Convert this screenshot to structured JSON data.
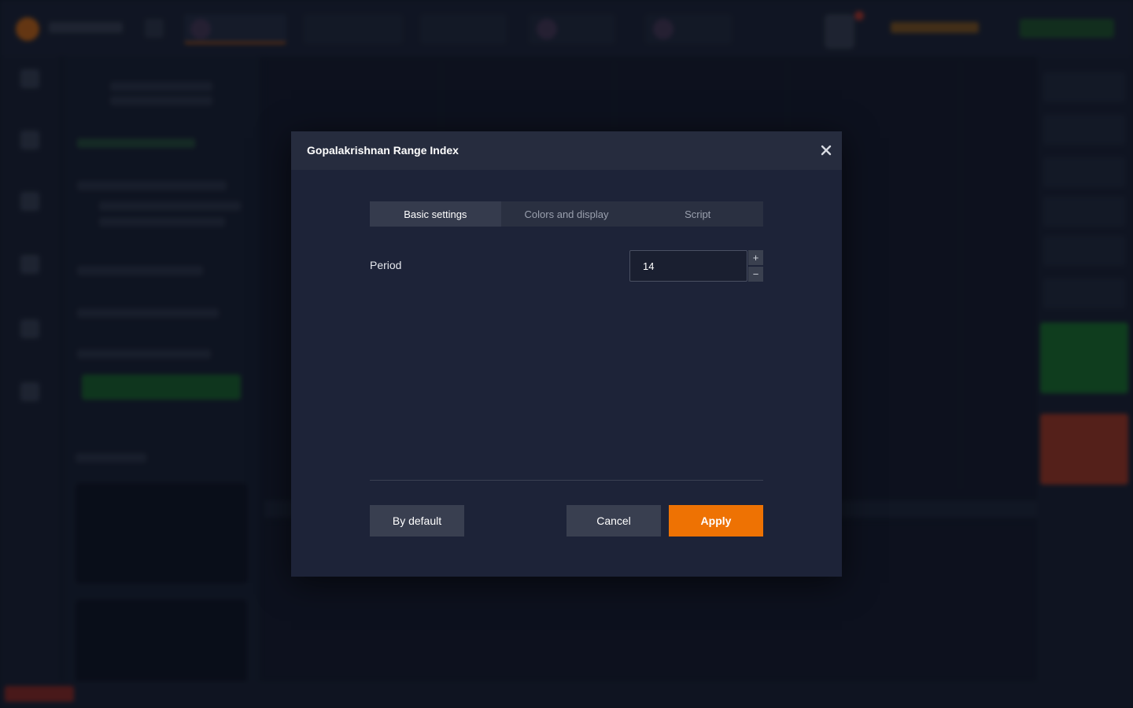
{
  "dialog": {
    "title": "Gopalakrishnan Range Index",
    "close_icon": "close-icon",
    "tabs": [
      {
        "label": "Basic settings",
        "active": true
      },
      {
        "label": "Colors and display",
        "active": false
      },
      {
        "label": "Script",
        "active": false
      }
    ],
    "fields": {
      "period": {
        "label": "Period",
        "value": "14",
        "increment_label": "+",
        "decrement_label": "−"
      }
    },
    "buttons": {
      "default_label": "By default",
      "cancel_label": "Cancel",
      "apply_label": "Apply"
    }
  },
  "colors": {
    "accent": "#ee7203",
    "dialog_bg": "#1d2338",
    "header_bg": "#262c3e"
  }
}
